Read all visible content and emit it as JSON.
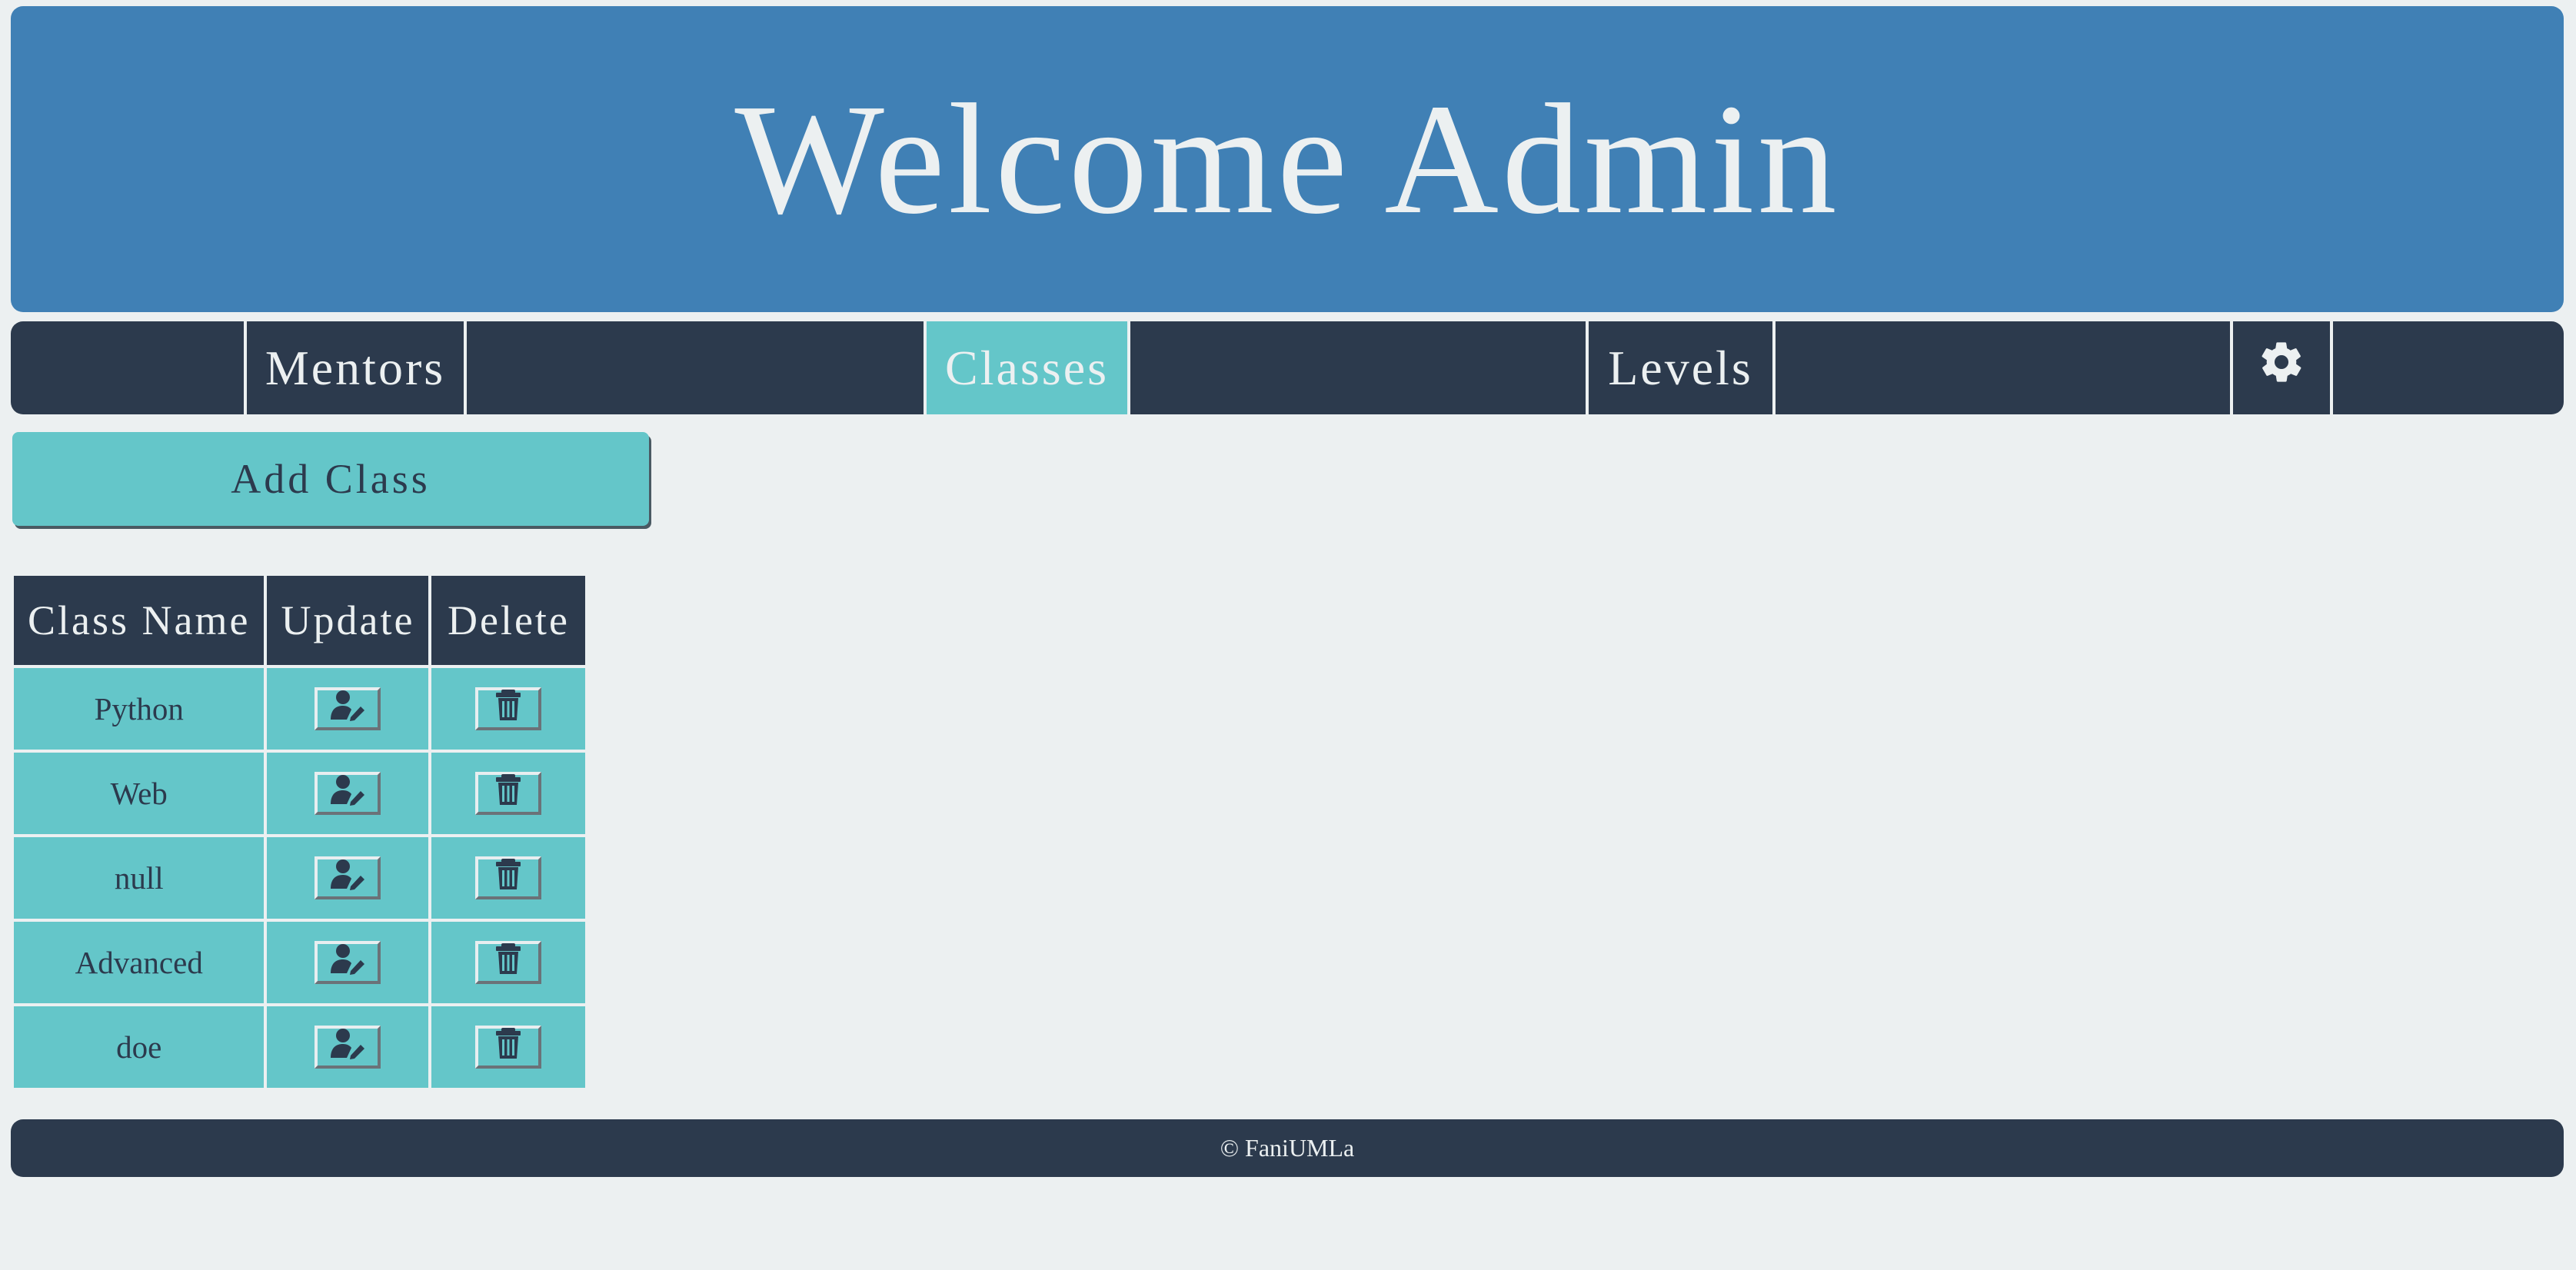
{
  "header": {
    "title": "Welcome Admin"
  },
  "nav": {
    "items": [
      {
        "label": "Mentors",
        "active": false
      },
      {
        "label": "Classes",
        "active": true
      },
      {
        "label": "Levels",
        "active": false
      }
    ],
    "settings_icon": "gear-icon"
  },
  "actions": {
    "add_label": "Add Class"
  },
  "table": {
    "headers": [
      "Class Name",
      "Update",
      "Delete"
    ],
    "rows": [
      {
        "name": "Python"
      },
      {
        "name": "Web"
      },
      {
        "name": "null"
      },
      {
        "name": "Advanced"
      },
      {
        "name": "doe"
      }
    ],
    "update_icon": "user-edit-icon",
    "delete_icon": "trash-icon"
  },
  "footer": {
    "text": "© FaniUMLa"
  },
  "colors": {
    "header_bg": "#4080b5",
    "nav_bg": "#2c3a4d",
    "accent": "#64c6c9",
    "page_bg": "#ecf0f1"
  }
}
